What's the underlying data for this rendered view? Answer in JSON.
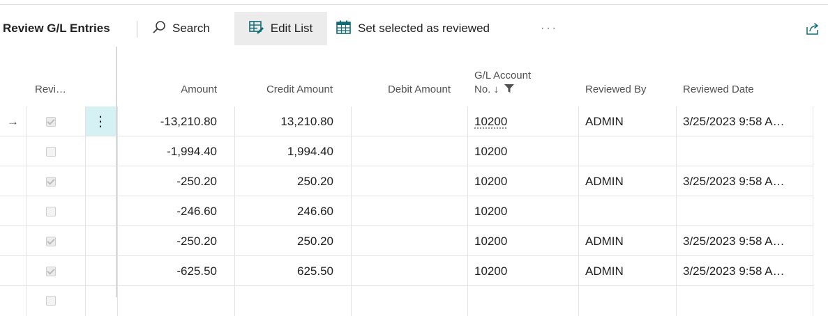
{
  "toolbar": {
    "title": "Review G/L Entries",
    "search_label": "Search",
    "edit_list_label": "Edit List",
    "set_reviewed_label": "Set selected as reviewed",
    "more_label": "···"
  },
  "table": {
    "headers": {
      "reviewed": "Revi…",
      "amount": "Amount",
      "credit": "Credit Amount",
      "debit": "Debit Amount",
      "gl_line1": "G/L Account",
      "gl_line2": "No. ↓",
      "reviewed_by": "Reviewed By",
      "reviewed_date": "Reviewed Date"
    },
    "current_row_marker": "→",
    "row_menu": "⋮",
    "rows": [
      {
        "reviewed": true,
        "amount": "-13,210.80",
        "credit": "13,210.80",
        "debit": "",
        "gl": "10200",
        "by": "ADMIN",
        "date": "3/25/2023 9:58 A…"
      },
      {
        "reviewed": false,
        "amount": "-1,994.40",
        "credit": "1,994.40",
        "debit": "",
        "gl": "10200",
        "by": "",
        "date": ""
      },
      {
        "reviewed": true,
        "amount": "-250.20",
        "credit": "250.20",
        "debit": "",
        "gl": "10200",
        "by": "ADMIN",
        "date": "3/25/2023 9:58 A…"
      },
      {
        "reviewed": false,
        "amount": "-246.60",
        "credit": "246.60",
        "debit": "",
        "gl": "10200",
        "by": "",
        "date": ""
      },
      {
        "reviewed": true,
        "amount": "-250.20",
        "credit": "250.20",
        "debit": "",
        "gl": "10200",
        "by": "ADMIN",
        "date": "3/25/2023 9:58 A…"
      },
      {
        "reviewed": true,
        "amount": "-625.50",
        "credit": "625.50",
        "debit": "",
        "gl": "10200",
        "by": "ADMIN",
        "date": "3/25/2023 9:58 A…"
      }
    ]
  },
  "colors": {
    "accent": "#0f6b74",
    "selected_cell": "#d6f1f4",
    "active_button_bg": "#ececec"
  }
}
